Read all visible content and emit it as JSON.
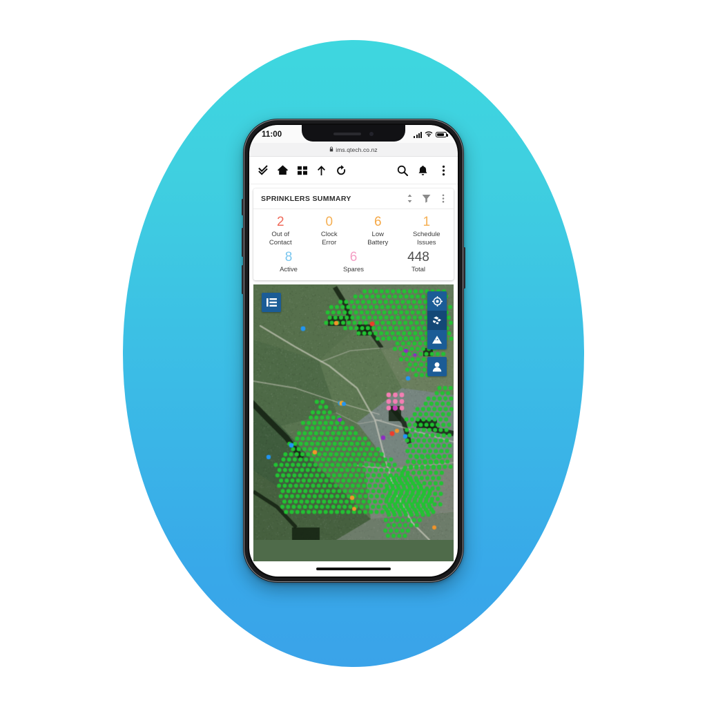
{
  "backdrop": {
    "gradient_top": "#3ed7df",
    "gradient_bottom": "#3aa3e9"
  },
  "status_bar": {
    "time": "11:00",
    "signal_icon": "cellular-signal-icon",
    "wifi_icon": "wifi-icon",
    "battery_icon": "battery-icon"
  },
  "browser": {
    "lock_icon": "lock-icon",
    "url": "ims.qtech.co.nz"
  },
  "toolbar": {
    "left_items": [
      {
        "name": "double-check-icon",
        "label": "Tasks"
      },
      {
        "name": "home-icon",
        "label": "Home"
      },
      {
        "name": "grid-icon",
        "label": "Dashboard"
      },
      {
        "name": "arrow-up-icon",
        "label": "Up"
      },
      {
        "name": "refresh-icon",
        "label": "Refresh"
      }
    ],
    "right_items": [
      {
        "name": "search-icon",
        "label": "Search"
      },
      {
        "name": "bell-icon",
        "label": "Notifications"
      },
      {
        "name": "kebab-menu-icon",
        "label": "More"
      }
    ]
  },
  "card": {
    "title": "SPRINKLERS SUMMARY",
    "actions": [
      {
        "name": "sort-icon",
        "label": "Sort"
      },
      {
        "name": "filter-icon",
        "label": "Filter"
      },
      {
        "name": "kebab-menu-icon",
        "label": "More options"
      }
    ],
    "stats_row_1": [
      {
        "value": "2",
        "label_line1": "Out of",
        "label_line2": "Contact",
        "color": "#ef6a5a"
      },
      {
        "value": "0",
        "label_line1": "Clock",
        "label_line2": "Error",
        "color": "#f5b055"
      },
      {
        "value": "6",
        "label_line1": "Low",
        "label_line2": "Battery",
        "color": "#f5a846"
      },
      {
        "value": "1",
        "label_line1": "Schedule",
        "label_line2": "Issues",
        "color": "#f5b055"
      }
    ],
    "stats_row_2": [
      {
        "value": "8",
        "label": "Active",
        "color": "#79c6ef"
      },
      {
        "value": "6",
        "label": "Spares",
        "color": "#f49ec4"
      },
      {
        "value": "448",
        "label": "Total",
        "color": "#4d4d4d"
      }
    ]
  },
  "map": {
    "legend_button": {
      "name": "list-legend-icon",
      "label": "Legend"
    },
    "controls": [
      {
        "name": "locate-target-icon",
        "label": "Locate me"
      },
      {
        "name": "layers-satellite-icon",
        "label": "Map layers"
      },
      {
        "name": "terrain-icon",
        "label": "Terrain"
      }
    ],
    "user_button": {
      "name": "user-icon",
      "label": "User"
    },
    "marker_colors": {
      "active": "#22c233",
      "out_of_contact": "#ee3b2a",
      "low_battery": "#f2952a",
      "spares": "#f47fb4",
      "schedule_issues": "#8e2bc4",
      "selected": "#2196f3"
    }
  },
  "home_indicator": {
    "name": "home-indicator"
  }
}
